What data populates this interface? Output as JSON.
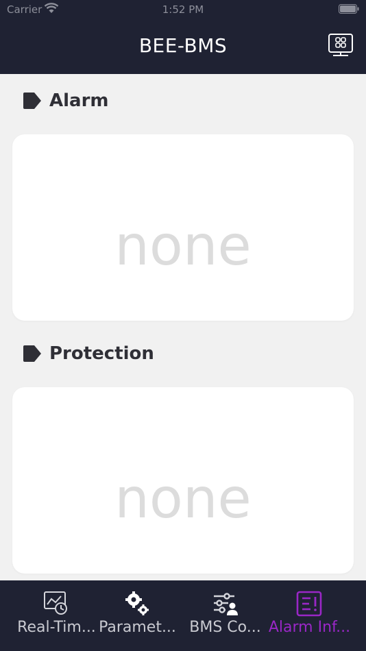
{
  "status_bar": {
    "carrier": "Carrier",
    "time": "1:52 PM"
  },
  "header": {
    "title": "BEE-BMS",
    "action_icon": "monitor-grid-icon"
  },
  "sections": [
    {
      "title": "Alarm",
      "empty_text": "none"
    },
    {
      "title": "Protection",
      "empty_text": "none"
    }
  ],
  "tabs": [
    {
      "label": "Real-Tim...",
      "icon": "realtime-chart-icon",
      "active": false
    },
    {
      "label": "Paramet...",
      "icon": "gears-icon",
      "active": false
    },
    {
      "label": "BMS Co...",
      "icon": "sliders-user-icon",
      "active": false
    },
    {
      "label": "Alarm Inf...",
      "icon": "alarm-info-icon",
      "active": true
    }
  ],
  "colors": {
    "bar_bg": "#1f2233",
    "accent": "#9a27c7",
    "page_bg": "#f1f1f1"
  }
}
